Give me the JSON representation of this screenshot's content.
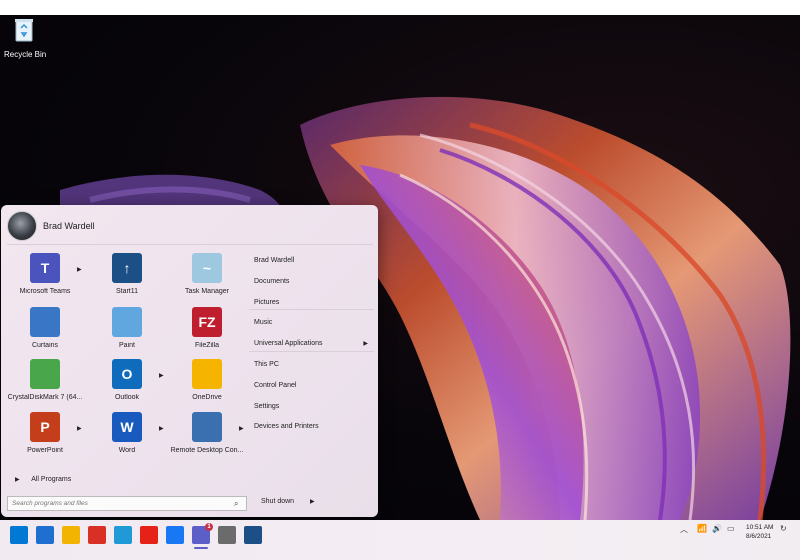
{
  "desktop": {
    "recycle_bin_label": "Recycle Bin"
  },
  "start_menu": {
    "user_name": "Brad Wardell",
    "pinned": [
      {
        "label": "Microsoft Teams",
        "icon": "teams-icon",
        "color": "#4b53bc",
        "glyph": "T",
        "has_arrow": true
      },
      {
        "label": "Start11",
        "icon": "start11-icon",
        "color": "#1b4f86",
        "glyph": "↑",
        "has_arrow": false
      },
      {
        "label": "Task Manager",
        "icon": "task-manager-icon",
        "color": "#9ec7e0",
        "glyph": "~",
        "has_arrow": false
      },
      {
        "label": "Curtains",
        "icon": "curtains-icon",
        "color": "#3a76c6",
        "glyph": "",
        "has_arrow": false
      },
      {
        "label": "Paint",
        "icon": "paint-icon",
        "color": "#5fa7de",
        "glyph": "",
        "has_arrow": false
      },
      {
        "label": "FileZilla",
        "icon": "filezilla-icon",
        "color": "#bf1e2e",
        "glyph": "FZ",
        "has_arrow": false
      },
      {
        "label": "CrystalDiskMark 7 (64...",
        "icon": "crystaldiskmark-icon",
        "color": "#49a64b",
        "glyph": "",
        "has_arrow": false
      },
      {
        "label": "Outlook",
        "icon": "outlook-icon",
        "color": "#0f6cbd",
        "glyph": "O",
        "has_arrow": true
      },
      {
        "label": "OneDrive",
        "icon": "onedrive-icon",
        "color": "#f5b400",
        "glyph": "",
        "has_arrow": false
      },
      {
        "label": "PowerPoint",
        "icon": "powerpoint-icon",
        "color": "#c43e1c",
        "glyph": "P",
        "has_arrow": true
      },
      {
        "label": "Word",
        "icon": "word-icon",
        "color": "#185abd",
        "glyph": "W",
        "has_arrow": true
      },
      {
        "label": "Remote Desktop Con...",
        "icon": "remote-desktop-icon",
        "color": "#3a6fb0",
        "glyph": "",
        "has_arrow": true
      }
    ],
    "right_items": [
      {
        "label": "Brad Wardell",
        "has_arrow": false
      },
      {
        "label": "Documents",
        "has_arrow": false
      },
      {
        "label": "Pictures",
        "has_arrow": false
      },
      {
        "label": "Music",
        "has_arrow": false
      },
      {
        "label": "Universal Applications",
        "has_arrow": true
      },
      {
        "label": "This PC",
        "has_arrow": false
      },
      {
        "label": "Control Panel",
        "has_arrow": false
      },
      {
        "label": "Settings",
        "has_arrow": false
      },
      {
        "label": "Devices and Printers",
        "has_arrow": false
      }
    ],
    "all_programs_label": "All Programs",
    "search_placeholder": "Search programs and files",
    "shutdown_label": "Shut down"
  },
  "taskbar": {
    "icons": [
      {
        "name": "windows-start-icon",
        "color": "#0078d4"
      },
      {
        "name": "task-view-icon",
        "color": "#1e6fd0"
      },
      {
        "name": "file-explorer-icon",
        "color": "#f2b400"
      },
      {
        "name": "gmail-icon",
        "color": "#d93025"
      },
      {
        "name": "edge-icon",
        "color": "#1f9ad6"
      },
      {
        "name": "youtube-icon",
        "color": "#e62117"
      },
      {
        "name": "facebook-icon",
        "color": "#1877f2"
      },
      {
        "name": "teams-taskbar-icon",
        "color": "#5b5fc7"
      },
      {
        "name": "settings-icon",
        "color": "#6b6b6b"
      },
      {
        "name": "start11-taskbar-icon",
        "color": "#1b4f86"
      }
    ],
    "teams_badge": "1",
    "time": "10:51 AM",
    "date": "8/6/2021"
  }
}
